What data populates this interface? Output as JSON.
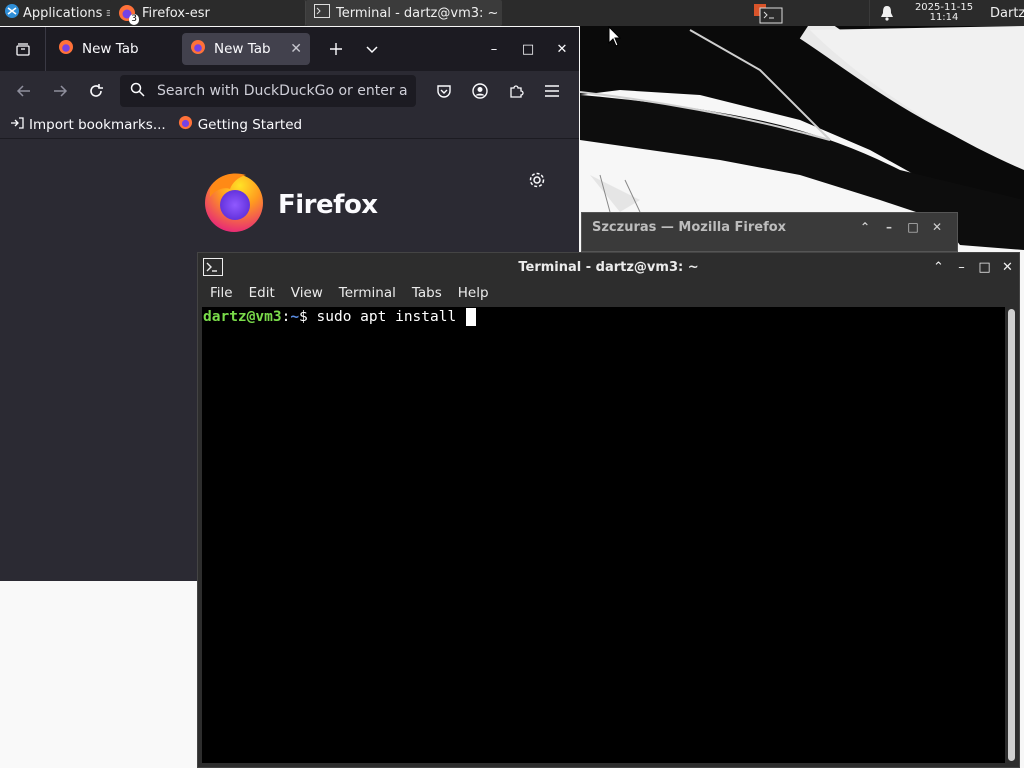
{
  "panel": {
    "applications_label": "Applications",
    "firefox_task_label": "Firefox-esr",
    "firefox_badge": "3",
    "terminal_task_label": "Terminal - dartz@vm3: ~",
    "clock_date": "2025-11-15",
    "clock_time": "11:14",
    "user_label": "Dartz"
  },
  "firefox": {
    "tabs": [
      {
        "label": "New Tab"
      },
      {
        "label": "New Tab"
      }
    ],
    "url_placeholder": "Search with DuckDuckGo or enter a",
    "bookmarks": [
      {
        "label": "Import bookmarks..."
      },
      {
        "label": "Getting Started"
      }
    ],
    "brand": "Firefox"
  },
  "background_window": {
    "title": "Szczuras — Mozilla Firefox"
  },
  "terminal": {
    "title": "Terminal - dartz@vm3: ~",
    "menu": [
      "File",
      "Edit",
      "View",
      "Terminal",
      "Tabs",
      "Help"
    ],
    "prompt_user": "dartz@vm3",
    "prompt_sep": ":",
    "prompt_path": "~",
    "prompt_symbol": "$ ",
    "command": "sudo apt install "
  },
  "colors": {
    "prompt_user": "#7adc4a",
    "prompt_path": "#5b8ee6",
    "panel_bg": "#2b2b2b",
    "firefox_chrome": "#2b2a33"
  },
  "icons": {
    "panel": [
      "xfce-applications-icon",
      "firefox-icon",
      "terminal-icon",
      "tray-app-icon",
      "notification-bell-icon"
    ],
    "firefox": [
      "list-all-tabs-icon",
      "firefox-tab-icon",
      "new-tab-plus-icon",
      "tab-list-chevron-icon",
      "back-arrow-icon",
      "forward-arrow-icon",
      "reload-icon",
      "search-icon",
      "pocket-icon",
      "account-icon",
      "extensions-icon",
      "hamburger-menu-icon",
      "import-icon",
      "settings-gear-icon"
    ]
  }
}
